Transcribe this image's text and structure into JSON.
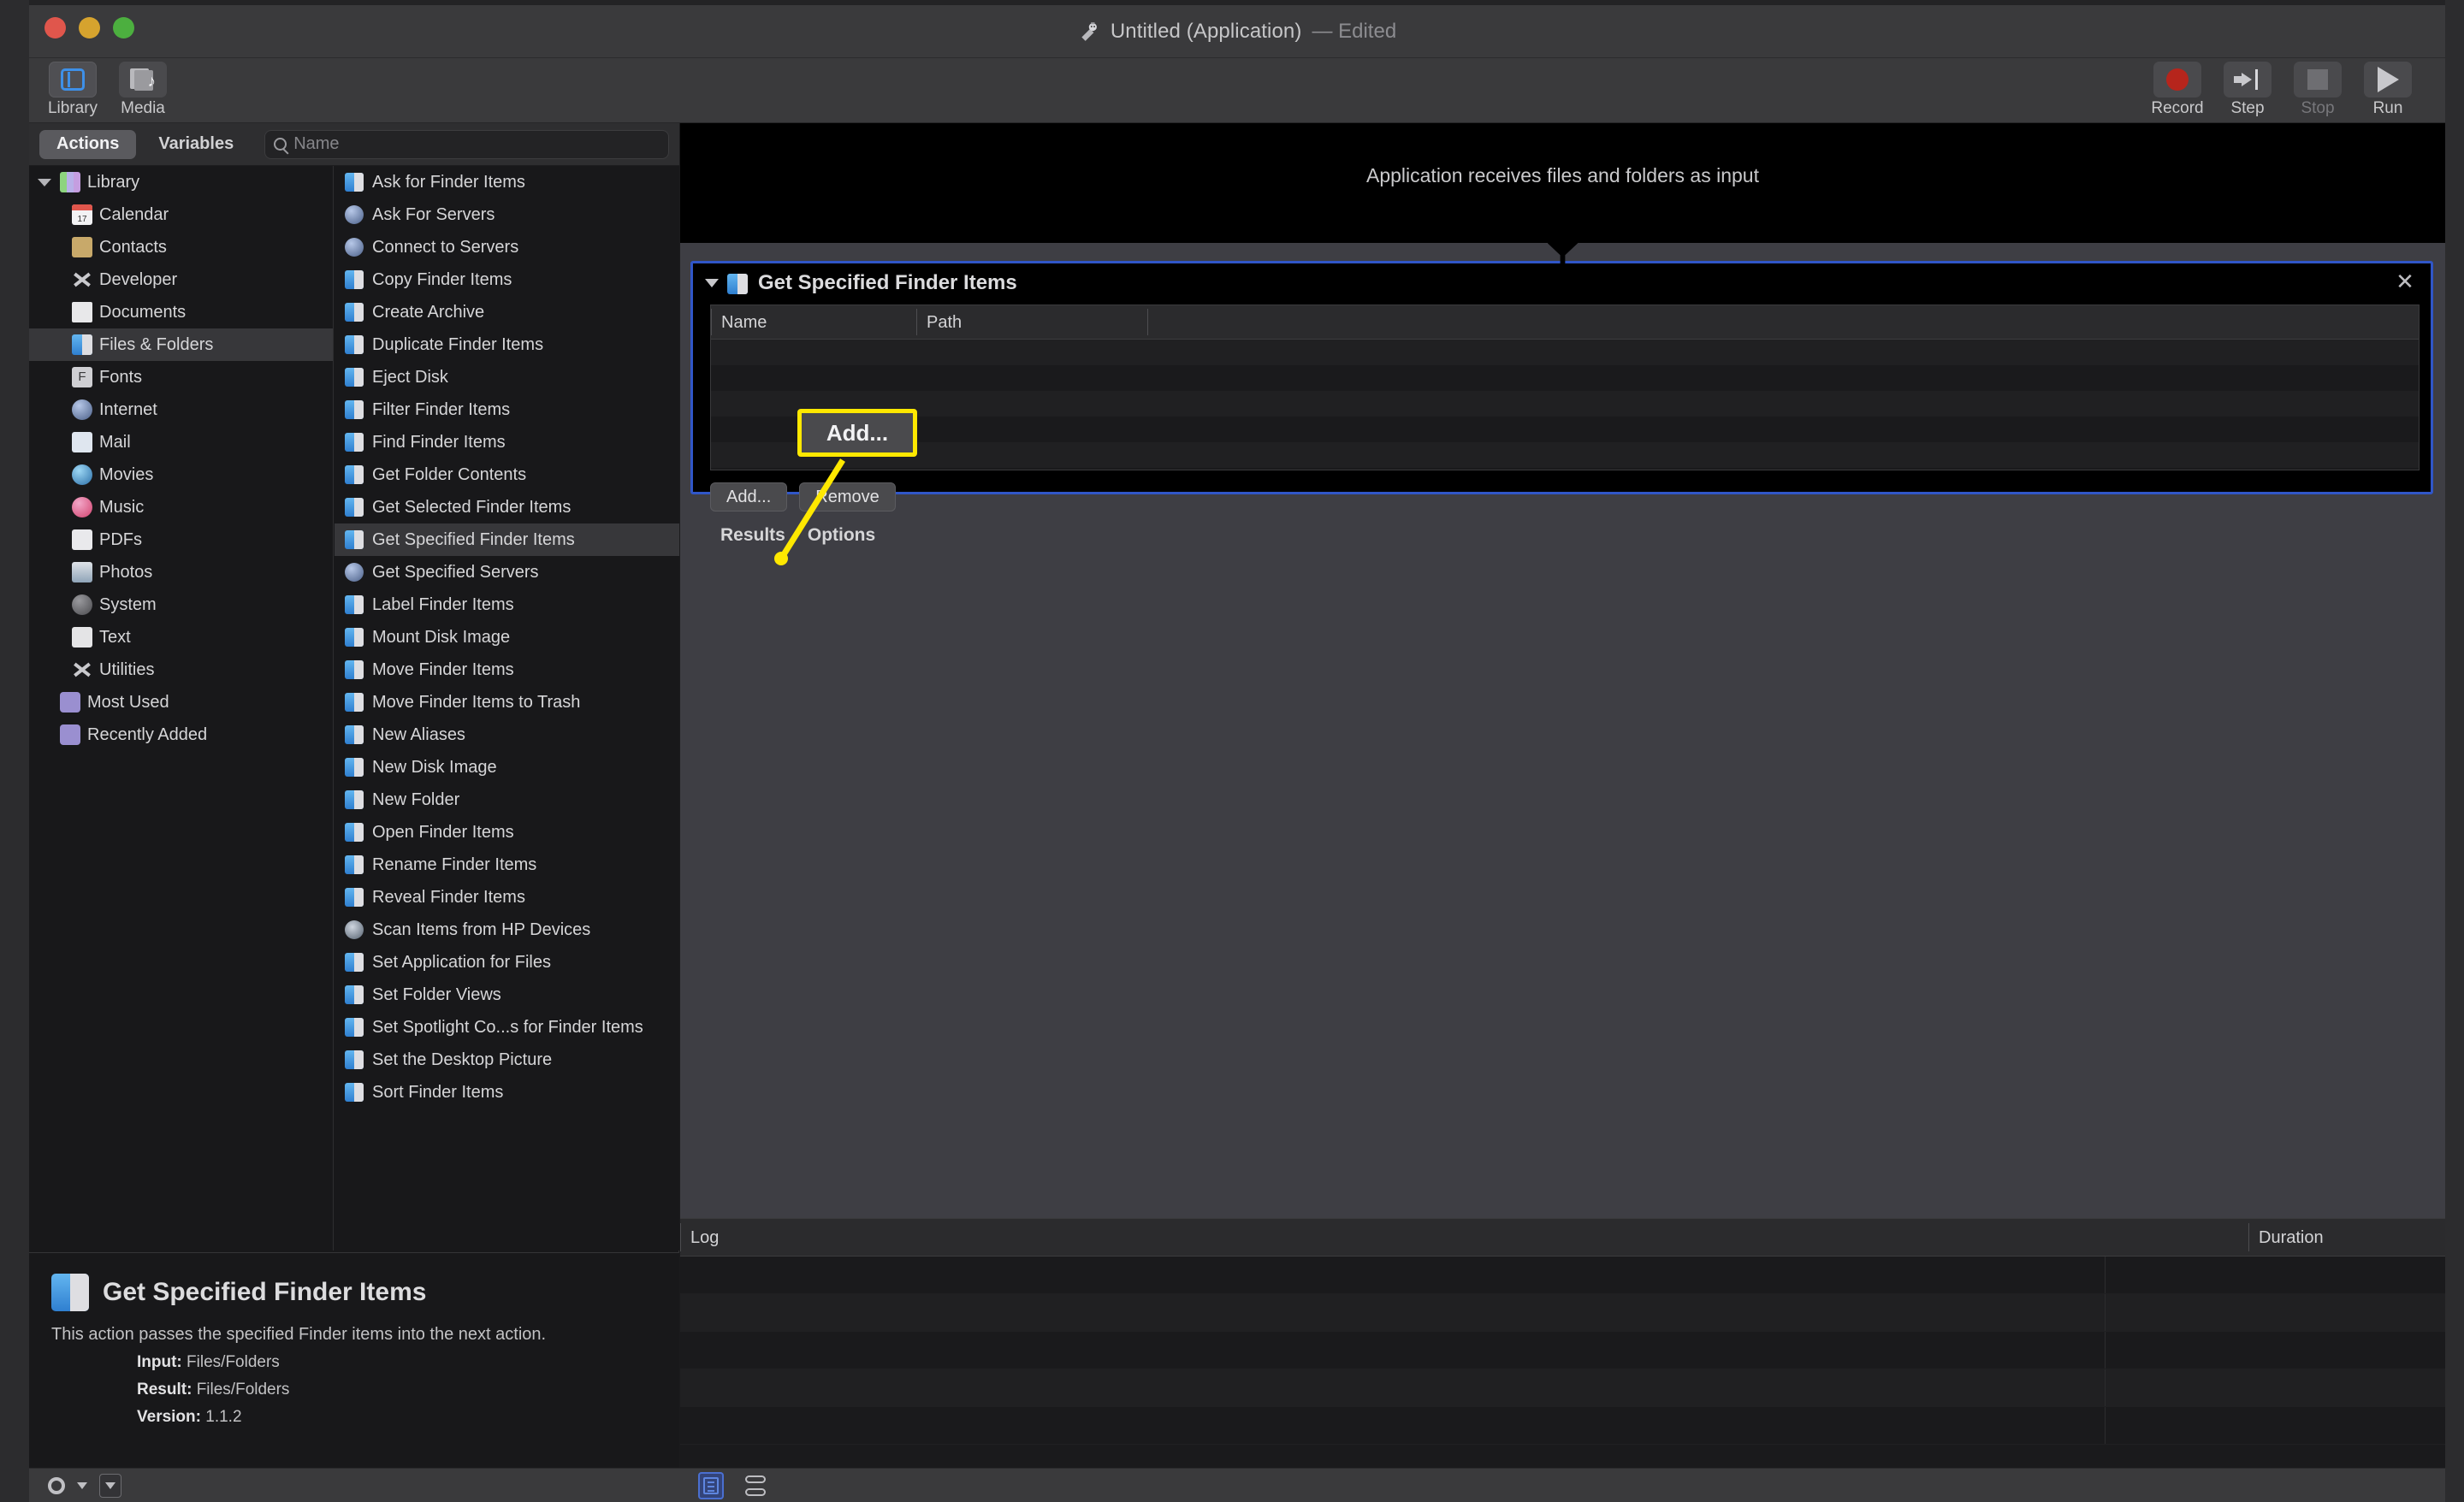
{
  "window": {
    "title": "Untitled (Application)",
    "edited_suffix": "— Edited",
    "app_icon": "automator-robot-icon"
  },
  "toolbar": {
    "left_items": [
      {
        "label": "Library",
        "icon": "library-panel-icon",
        "selected": true
      },
      {
        "label": "Media",
        "icon": "media-icon",
        "selected": false
      }
    ],
    "right_items": [
      {
        "label": "Record",
        "icon": "record-circle-icon",
        "enabled": true
      },
      {
        "label": "Step",
        "icon": "step-arrow-icon",
        "enabled": true
      },
      {
        "label": "Stop",
        "icon": "stop-square-icon",
        "enabled": false
      },
      {
        "label": "Run",
        "icon": "run-triangle-icon",
        "enabled": true
      }
    ]
  },
  "library": {
    "tabs": [
      {
        "label": "Actions",
        "selected": true
      },
      {
        "label": "Variables",
        "selected": false
      }
    ],
    "search": {
      "placeholder": "Name",
      "value": "",
      "icon": "search-icon"
    },
    "tree": [
      {
        "label": "Library",
        "icon": "library-icon",
        "level": 0,
        "expanded": true,
        "selected": false
      },
      {
        "label": "Calendar",
        "icon": "calendar-icon",
        "level": 1,
        "selected": false
      },
      {
        "label": "Contacts",
        "icon": "contacts-icon",
        "level": 1,
        "selected": false
      },
      {
        "label": "Developer",
        "icon": "developer-icon",
        "level": 1,
        "selected": false
      },
      {
        "label": "Documents",
        "icon": "documents-icon",
        "level": 1,
        "selected": false
      },
      {
        "label": "Files & Folders",
        "icon": "finder-icon",
        "level": 1,
        "selected": true
      },
      {
        "label": "Fonts",
        "icon": "fonts-icon",
        "level": 1,
        "selected": false
      },
      {
        "label": "Internet",
        "icon": "internet-icon",
        "level": 1,
        "selected": false
      },
      {
        "label": "Mail",
        "icon": "mail-icon",
        "level": 1,
        "selected": false
      },
      {
        "label": "Movies",
        "icon": "movies-icon",
        "level": 1,
        "selected": false
      },
      {
        "label": "Music",
        "icon": "music-icon",
        "level": 1,
        "selected": false
      },
      {
        "label": "PDFs",
        "icon": "pdf-icon",
        "level": 1,
        "selected": false
      },
      {
        "label": "Photos",
        "icon": "photos-icon",
        "level": 1,
        "selected": false
      },
      {
        "label": "System",
        "icon": "system-icon",
        "level": 1,
        "selected": false
      },
      {
        "label": "Text",
        "icon": "text-icon",
        "level": 1,
        "selected": false
      },
      {
        "label": "Utilities",
        "icon": "utilities-icon",
        "level": 1,
        "selected": false
      },
      {
        "label": "Most Used",
        "icon": "smart-folder-icon",
        "level": 0,
        "selected": false
      },
      {
        "label": "Recently Added",
        "icon": "smart-folder-icon",
        "level": 0,
        "selected": false
      }
    ],
    "actions": [
      {
        "label": "Ask for Finder Items",
        "icon": "finder-icon",
        "selected": false
      },
      {
        "label": "Ask For Servers",
        "icon": "network-icon",
        "selected": false
      },
      {
        "label": "Connect to Servers",
        "icon": "network-icon",
        "selected": false
      },
      {
        "label": "Copy Finder Items",
        "icon": "finder-icon",
        "selected": false
      },
      {
        "label": "Create Archive",
        "icon": "finder-icon",
        "selected": false
      },
      {
        "label": "Duplicate Finder Items",
        "icon": "finder-icon",
        "selected": false
      },
      {
        "label": "Eject Disk",
        "icon": "finder-icon",
        "selected": false
      },
      {
        "label": "Filter Finder Items",
        "icon": "finder-icon",
        "selected": false
      },
      {
        "label": "Find Finder Items",
        "icon": "finder-icon",
        "selected": false
      },
      {
        "label": "Get Folder Contents",
        "icon": "finder-icon",
        "selected": false
      },
      {
        "label": "Get Selected Finder Items",
        "icon": "finder-icon",
        "selected": false
      },
      {
        "label": "Get Specified Finder Items",
        "icon": "finder-icon",
        "selected": true
      },
      {
        "label": "Get Specified Servers",
        "icon": "network-icon",
        "selected": false
      },
      {
        "label": "Label Finder Items",
        "icon": "finder-icon",
        "selected": false
      },
      {
        "label": "Mount Disk Image",
        "icon": "finder-icon",
        "selected": false
      },
      {
        "label": "Move Finder Items",
        "icon": "finder-icon",
        "selected": false
      },
      {
        "label": "Move Finder Items to Trash",
        "icon": "finder-icon",
        "selected": false
      },
      {
        "label": "New Aliases",
        "icon": "finder-icon",
        "selected": false
      },
      {
        "label": "New Disk Image",
        "icon": "finder-icon",
        "selected": false
      },
      {
        "label": "New Folder",
        "icon": "finder-icon",
        "selected": false
      },
      {
        "label": "Open Finder Items",
        "icon": "finder-icon",
        "selected": false
      },
      {
        "label": "Rename Finder Items",
        "icon": "finder-icon",
        "selected": false
      },
      {
        "label": "Reveal Finder Items",
        "icon": "finder-icon",
        "selected": false
      },
      {
        "label": "Scan Items from HP Devices",
        "icon": "hp-scanner-icon",
        "selected": false
      },
      {
        "label": "Set Application for Files",
        "icon": "finder-icon",
        "selected": false
      },
      {
        "label": "Set Folder Views",
        "icon": "finder-icon",
        "selected": false
      },
      {
        "label": "Set Spotlight Co...s for Finder Items",
        "icon": "finder-icon",
        "selected": false
      },
      {
        "label": "Set the Desktop Picture",
        "icon": "finder-icon",
        "selected": false
      },
      {
        "label": "Sort Finder Items",
        "icon": "finder-icon",
        "selected": false
      }
    ]
  },
  "info_pane": {
    "icon": "finder-icon",
    "title": "Get Specified Finder Items",
    "description": "This action passes the specified Finder items into the next action.",
    "fields": [
      {
        "key": "Input:",
        "value": "Files/Folders"
      },
      {
        "key": "Result:",
        "value": "Files/Folders"
      },
      {
        "key": "Version:",
        "value": "1.1.2"
      }
    ]
  },
  "workflow": {
    "input_header": "Application receives files and folders as input",
    "action_card": {
      "icon": "finder-icon",
      "title": "Get Specified Finder Items",
      "disclosure": "triangle-down-icon",
      "close_label": "✕",
      "table": {
        "columns": [
          "Name",
          "Path",
          ""
        ],
        "rows": []
      },
      "buttons": [
        {
          "label": "Add..."
        },
        {
          "label": "Remove"
        }
      ],
      "tabs": [
        {
          "label": "Results"
        },
        {
          "label": "Options"
        }
      ],
      "selected_border_color": "#3056c8"
    }
  },
  "log_pane": {
    "columns": [
      "Log",
      "Duration"
    ],
    "rows": []
  },
  "status_bar": {
    "gear_icon": "gear-icon",
    "chevron_icon": "chevron-down-icon",
    "checkbox_icon": "checkbox-icon",
    "view_toggles": [
      {
        "icon": "list-view-icon",
        "selected": true
      },
      {
        "icon": "stack-view-icon",
        "selected": false
      }
    ]
  },
  "annotation": {
    "label": "Add...",
    "color": "#ffe800",
    "target": "add-button"
  }
}
